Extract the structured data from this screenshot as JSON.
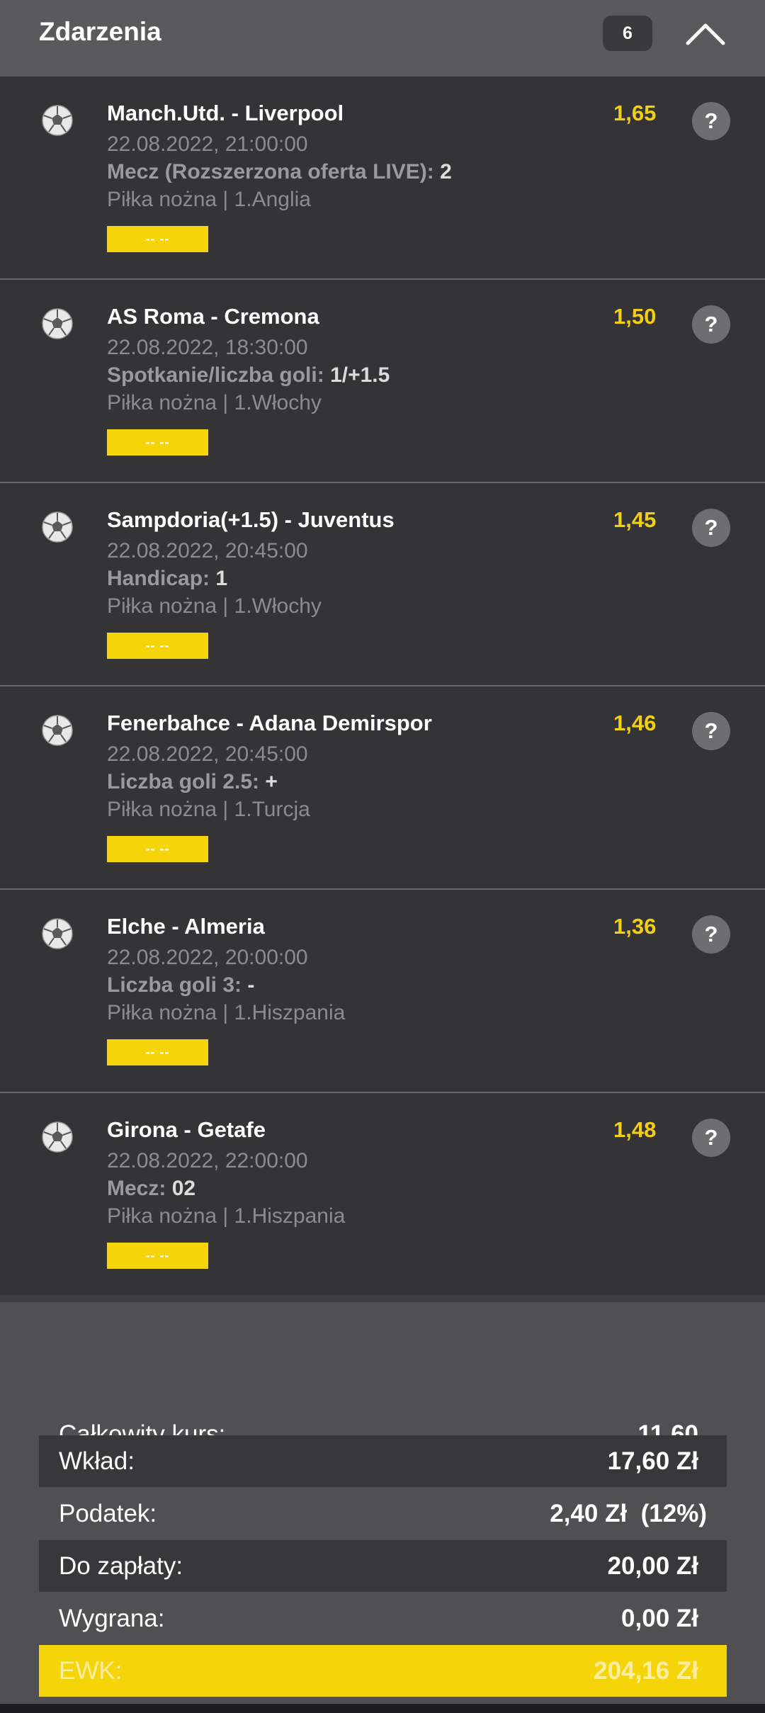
{
  "header": {
    "title": "Zdarzenia",
    "count": "6"
  },
  "events": [
    {
      "name": "Manch.Utd. - Liverpool",
      "date": "22.08.2022, 21:00:00",
      "market": "Mecz (Rozszerzona oferta LIVE):",
      "pick": "2",
      "league": "Piłka nożna | 1.Anglia",
      "result": "-- --",
      "odds": "1,65",
      "help": "?"
    },
    {
      "name": "AS Roma - Cremona",
      "date": "22.08.2022, 18:30:00",
      "market": "Spotkanie/liczba goli:",
      "pick": "1/+1.5",
      "league": "Piłka nożna | 1.Włochy",
      "result": "-- --",
      "odds": "1,50",
      "help": "?"
    },
    {
      "name": "Sampdoria(+1.5) - Juventus",
      "date": "22.08.2022, 20:45:00",
      "market": "Handicap:",
      "pick": "1",
      "league": "Piłka nożna | 1.Włochy",
      "result": "-- --",
      "odds": "1,45",
      "help": "?"
    },
    {
      "name": "Fenerbahce - Adana Demirspor",
      "date": "22.08.2022, 20:45:00",
      "market": "Liczba goli 2.5:",
      "pick": "+",
      "league": "Piłka nożna | 1.Turcja",
      "result": "-- --",
      "odds": "1,46",
      "help": "?"
    },
    {
      "name": "Elche - Almeria",
      "date": "22.08.2022, 20:00:00",
      "market": "Liczba goli 3:",
      "pick": "-",
      "league": "Piłka nożna | 1.Hiszpania",
      "result": "-- --",
      "odds": "1,36",
      "help": "?"
    },
    {
      "name": "Girona - Getafe",
      "date": "22.08.2022, 22:00:00",
      "market": "Mecz:",
      "pick": "02",
      "league": "Piłka nożna | 1.Hiszpania",
      "result": "-- --",
      "odds": "1,48",
      "help": "?"
    }
  ],
  "summary": {
    "total_odds_label": "Całkowity kurs:",
    "total_odds_value": "11,60",
    "stake_label": "Wkład:",
    "stake_value": "17,60 Zł",
    "tax_label": "Podatek:",
    "tax_value": "2,40 Zł  (12%)",
    "to_pay_label": "Do zapłaty:",
    "to_pay_value": "20,00 Zł",
    "win_label": "Wygrana:",
    "win_value": "0,00 Zł",
    "ewk_label": "EWK:",
    "ewk_value": "204,16 Zł"
  },
  "colors": {
    "accent": "#f5d50a",
    "odds": "#f2cf14",
    "background": "#343437"
  },
  "icons": {
    "sport": "soccer-ball-icon",
    "help": "question-mark-icon",
    "collapse": "chevron-up-icon"
  }
}
